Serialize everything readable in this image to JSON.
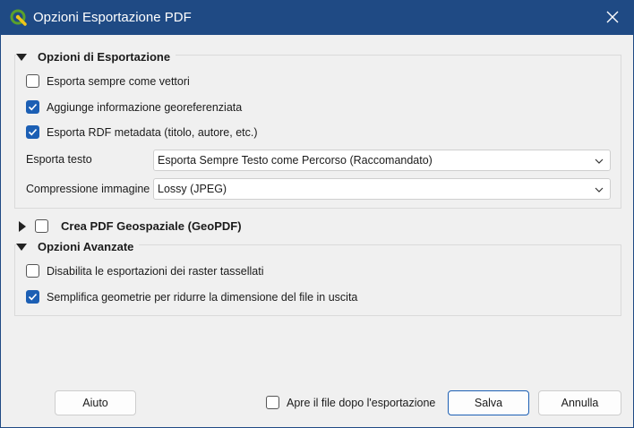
{
  "window": {
    "title": "Opzioni Esportazione PDF",
    "app_icon": "qgis-icon",
    "close_icon": "close-icon"
  },
  "export_options": {
    "header": "Opzioni di Esportazione",
    "checkboxes": [
      {
        "label": "Esporta sempre come vettori",
        "checked": false
      },
      {
        "label": "Aggiunge informazione georeferenziata",
        "checked": true
      },
      {
        "label": "Esporta RDF metadata (titolo, autore, etc.)",
        "checked": true
      }
    ],
    "text_export": {
      "label": "Esporta testo",
      "value": "Esporta Sempre Testo come Percorso (Raccomandato)"
    },
    "image_compression": {
      "label": "Compressione immagine",
      "value": "Lossy (JPEG)"
    }
  },
  "geopdf": {
    "label": "Crea PDF Geospaziale (GeoPDF)",
    "checked": false,
    "expanded": false
  },
  "advanced": {
    "header": "Opzioni Avanzate",
    "checkboxes": [
      {
        "label": "Disabilita le esportazioni dei raster tassellati",
        "checked": false
      },
      {
        "label": "Semplifica geometrie per ridurre la dimensione del file in uscita",
        "checked": true
      }
    ]
  },
  "footer": {
    "help_label": "Aiuto",
    "open_after_label": "Apre il file dopo l'esportazione",
    "open_after_checked": false,
    "save_label": "Salva",
    "cancel_label": "Annulla"
  },
  "colors": {
    "titlebar": "#1f4a84",
    "checkbox_checked": "#1c5fb4",
    "qgis_green": "#5aa02c",
    "qgis_yellow": "#f0c419"
  }
}
